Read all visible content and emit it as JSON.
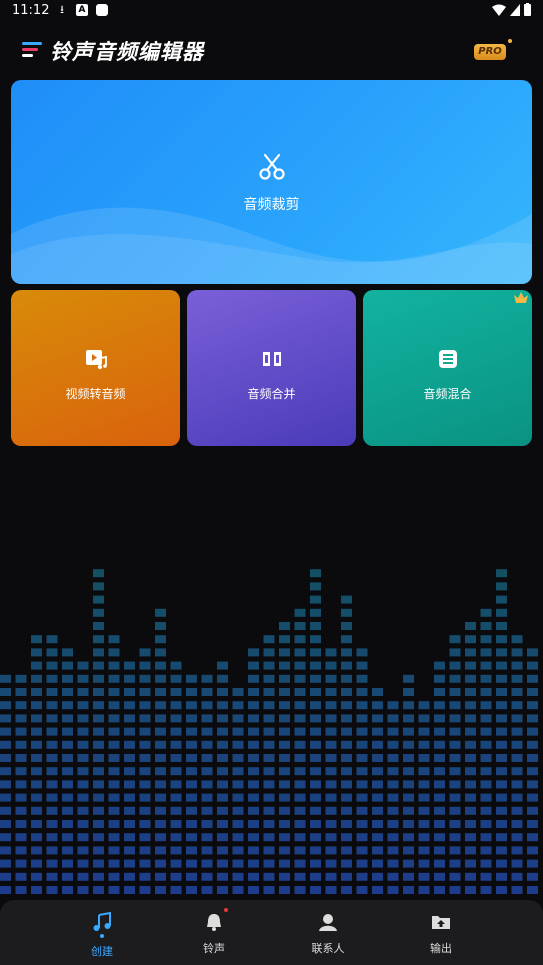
{
  "status_bar": {
    "time": "11:12"
  },
  "header": {
    "title": "铃声音频编辑器",
    "pro_label": "PRO"
  },
  "main_card": {
    "label": "音频裁剪",
    "icon": "scissors-icon"
  },
  "feature_cards": [
    {
      "label": "视频转音频",
      "icon": "video-music-icon",
      "color": "#d97a0b"
    },
    {
      "label": "音频合并",
      "icon": "merge-icon",
      "color": "#5e4ac8"
    },
    {
      "label": "音频混合",
      "icon": "mix-icon",
      "color": "#10a893",
      "premium": true
    }
  ],
  "bottom_nav": [
    {
      "label": "创建",
      "icon": "music-note-icon",
      "active": true
    },
    {
      "label": "铃声",
      "icon": "bell-icon",
      "badge": true
    },
    {
      "label": "联系人",
      "icon": "contact-icon"
    },
    {
      "label": "输出",
      "icon": "folder-upload-icon"
    }
  ],
  "colors": {
    "accent": "#3ba8ff",
    "background": "#0b0b0d"
  }
}
